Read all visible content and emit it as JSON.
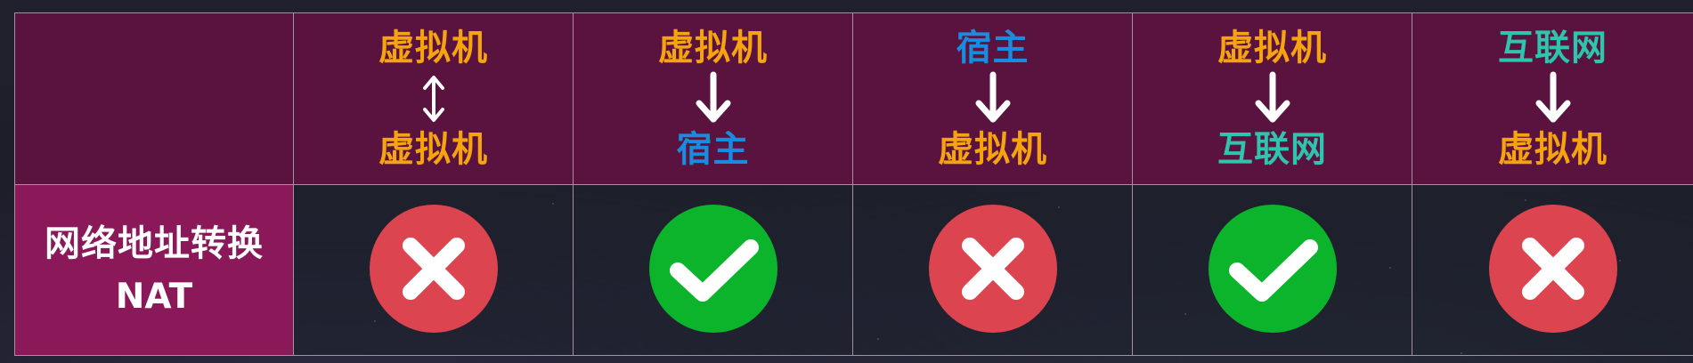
{
  "colors": {
    "vm": "#f5a40f",
    "host": "#1a8ce0",
    "internet": "#2ec4ae",
    "fail": "#dc4550",
    "ok": "#0cb42c"
  },
  "row_label": {
    "zh": "网络地址转换",
    "en": "NAT"
  },
  "columns": [
    {
      "from": "虚拟机",
      "to": "虚拟机",
      "from_color": "vm",
      "to_color": "vm",
      "arrow": "double-arrow-icon",
      "result": "fail"
    },
    {
      "from": "虚拟机",
      "to": "宿主",
      "from_color": "vm",
      "to_color": "host",
      "arrow": "down-arrow-icon",
      "result": "ok"
    },
    {
      "from": "宿主",
      "to": "虚拟机",
      "from_color": "host",
      "to_color": "vm",
      "arrow": "down-arrow-icon",
      "result": "fail"
    },
    {
      "from": "虚拟机",
      "to": "互联网",
      "from_color": "vm",
      "to_color": "internet",
      "arrow": "down-arrow-icon",
      "result": "ok"
    },
    {
      "from": "互联网",
      "to": "虚拟机",
      "from_color": "internet",
      "to_color": "vm",
      "arrow": "down-arrow-icon",
      "result": "fail"
    }
  ]
}
